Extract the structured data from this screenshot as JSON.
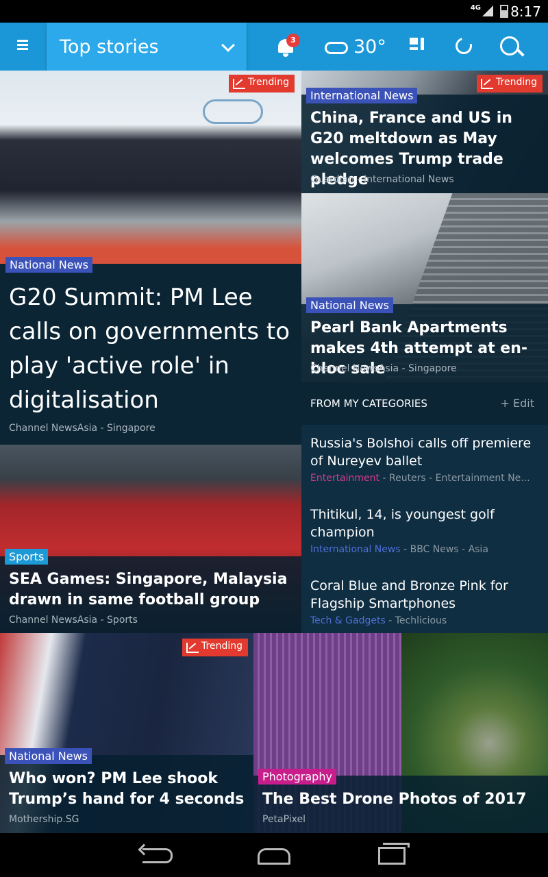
{
  "status_bar": {
    "network": "4G",
    "time": "8:17"
  },
  "toolbar": {
    "section": "Top stories",
    "notifications_count": "3",
    "temperature": "30°",
    "icons": [
      "menu-icon",
      "chevron-down-icon",
      "bell-icon",
      "weather-cloud-sun-icon",
      "layout-icon",
      "refresh-icon",
      "globe-search-icon"
    ]
  },
  "tiles": {
    "g20": {
      "badge": "Trending",
      "category": "National News",
      "headline": "G20 Summit: PM Lee calls on governments to play 'active role' in digitalisation",
      "source": "Channel NewsAsia - Singapore"
    },
    "china": {
      "badge": "Trending",
      "category": "International News",
      "headline": "China, France and US in G20 meltdown as May welcomes Trump trade pledge",
      "source": "Guardian - International News"
    },
    "pearl": {
      "category": "National News",
      "headline": "Pearl Bank Apartments makes 4th attempt at en-bloc sale",
      "source": "Channel NewsAsia - Singapore"
    },
    "seagames": {
      "category": "Sports",
      "headline": "SEA Games: Singapore, Malaysia drawn in same football group",
      "source": "Channel NewsAsia - Sports"
    },
    "trump": {
      "badge": "Trending",
      "category": "National News",
      "headline": "Who won? PM Lee shook Trump’s hand for 4 seconds",
      "source": "Mothership.SG"
    },
    "drone": {
      "category": "Photography",
      "headline": "The Best Drone Photos of 2017",
      "source": "PetaPixel"
    }
  },
  "my_categories": {
    "title": "FROM MY CATEGORIES",
    "edit_label": "+ Edit",
    "items": [
      {
        "title": "Russia's Bolshoi calls off premiere of Nureyev ballet",
        "category": "Entertainment",
        "category_color": "#d63a8e",
        "source": " - Reuters - Entertainment Ne..."
      },
      {
        "title": "Thitikul, 14, is youngest golf champion",
        "category": "International News",
        "category_color": "#4f6fd8",
        "source": " - BBC News - Asia"
      },
      {
        "title": "Coral Blue and Bronze Pink for Flagship Smartphones",
        "category": "Tech & Gadgets",
        "category_color": "#4f6fd8",
        "source": " - Techlicious"
      }
    ]
  },
  "nav": {
    "icons": [
      "back-icon",
      "home-icon",
      "recent-apps-icon"
    ]
  }
}
